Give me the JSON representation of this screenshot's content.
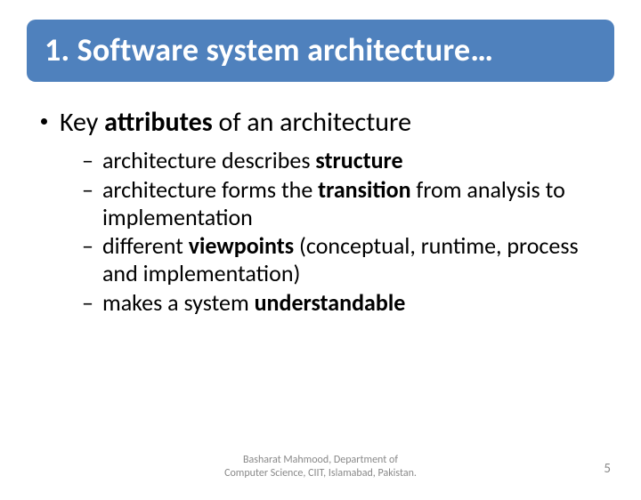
{
  "title": "1. Software system architecture…",
  "bullet": {
    "pre": "Key ",
    "bold": "attributes",
    "post": " of an architecture"
  },
  "subs": [
    {
      "pre": "architecture describes ",
      "bold": "structure",
      "post": ""
    },
    {
      "pre": "architecture forms the ",
      "bold": "transition",
      "post": " from analysis to implementation"
    },
    {
      "pre": "different ",
      "bold": "viewpoints",
      "post": " (conceptual, runtime, process and implementation)"
    },
    {
      "pre": "makes a system ",
      "bold": "understandable",
      "post": ""
    }
  ],
  "footer": {
    "line1": "Basharat Mahmood, Department of",
    "line2": "Computer Science, CIIT, Islamabad, Pakistan."
  },
  "page_number": "5"
}
